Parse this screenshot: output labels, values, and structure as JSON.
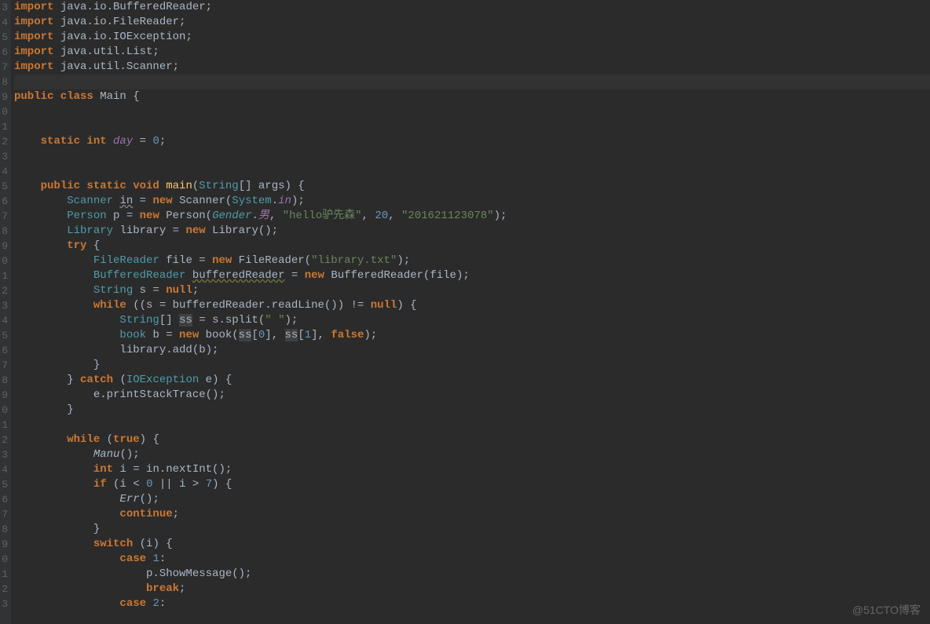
{
  "watermark": "@51CTO博客",
  "gutter": [
    "3",
    "4",
    "5",
    "6",
    "7",
    "8",
    "9",
    "0",
    "1",
    "2",
    "3",
    "4",
    "5",
    "6",
    "7",
    "8",
    "9",
    "0",
    "1",
    "2",
    "3",
    "4",
    "5",
    "6",
    "7",
    "8",
    "9",
    "0",
    "1",
    "2",
    "3",
    "4",
    "5",
    "6",
    "7",
    "8",
    "9",
    "0",
    "1",
    "2",
    "3"
  ],
  "code": {
    "l3": {
      "p": [
        {
          "t": "import ",
          "c": "kw"
        },
        {
          "t": "java.io.BufferedReader;",
          "c": ""
        }
      ]
    },
    "l4": {
      "p": [
        {
          "t": "import ",
          "c": "kw"
        },
        {
          "t": "java.io.FileReader;",
          "c": ""
        }
      ]
    },
    "l5": {
      "p": [
        {
          "t": "import ",
          "c": "kw"
        },
        {
          "t": "java.io.IOException;",
          "c": ""
        }
      ]
    },
    "l6": {
      "p": [
        {
          "t": "import ",
          "c": "kw"
        },
        {
          "t": "java.util.List;",
          "c": ""
        }
      ]
    },
    "l7": {
      "p": [
        {
          "t": "import ",
          "c": "kw"
        },
        {
          "t": "java.util.Scanner;",
          "c": ""
        }
      ]
    },
    "l8": {
      "p": [
        {
          "t": "",
          "c": ""
        }
      ]
    },
    "l9": {
      "p": [
        {
          "t": "public class ",
          "c": "kw"
        },
        {
          "t": "Main ",
          "c": "cls"
        },
        {
          "t": "{",
          "c": ""
        }
      ]
    },
    "l10": {
      "p": [
        {
          "t": "",
          "c": ""
        }
      ]
    },
    "l11": {
      "p": [
        {
          "t": "",
          "c": ""
        }
      ]
    },
    "l12": {
      "p": [
        {
          "t": "    ",
          "c": ""
        },
        {
          "t": "static int ",
          "c": "kw"
        },
        {
          "t": "day",
          "c": "field"
        },
        {
          "t": " = ",
          "c": ""
        },
        {
          "t": "0",
          "c": "num"
        },
        {
          "t": ";",
          "c": ""
        }
      ]
    },
    "l13": {
      "p": [
        {
          "t": "",
          "c": ""
        }
      ]
    },
    "l14": {
      "p": [
        {
          "t": "",
          "c": ""
        }
      ]
    },
    "l15": {
      "p": [
        {
          "t": "    ",
          "c": ""
        },
        {
          "t": "public static void ",
          "c": "kw"
        },
        {
          "t": "main",
          "c": "fn"
        },
        {
          "t": "(",
          "c": ""
        },
        {
          "t": "String",
          "c": "type"
        },
        {
          "t": "[] args) {",
          "c": ""
        }
      ]
    },
    "l16": {
      "p": [
        {
          "t": "        ",
          "c": ""
        },
        {
          "t": "Scanner ",
          "c": "type"
        },
        {
          "t": "in",
          "c": "under"
        },
        {
          "t": " = ",
          "c": ""
        },
        {
          "t": "new ",
          "c": "kw"
        },
        {
          "t": "Scanner(",
          "c": ""
        },
        {
          "t": "System",
          "c": "type"
        },
        {
          "t": ".",
          "c": ""
        },
        {
          "t": "in",
          "c": "field"
        },
        {
          "t": ");",
          "c": ""
        }
      ]
    },
    "l17": {
      "p": [
        {
          "t": "        ",
          "c": ""
        },
        {
          "t": "Person ",
          "c": "type"
        },
        {
          "t": "p = ",
          "c": ""
        },
        {
          "t": "new ",
          "c": "kw"
        },
        {
          "t": "Person(",
          "c": ""
        },
        {
          "t": "Gender",
          "c": "type italic"
        },
        {
          "t": ".",
          "c": ""
        },
        {
          "t": "男",
          "c": "field"
        },
        {
          "t": ", ",
          "c": ""
        },
        {
          "t": "\"hello驴先森\"",
          "c": "str"
        },
        {
          "t": ", ",
          "c": ""
        },
        {
          "t": "20",
          "c": "num"
        },
        {
          "t": ", ",
          "c": ""
        },
        {
          "t": "\"201621123078\"",
          "c": "str"
        },
        {
          "t": ");",
          "c": ""
        }
      ]
    },
    "l18": {
      "p": [
        {
          "t": "        ",
          "c": ""
        },
        {
          "t": "Library ",
          "c": "type"
        },
        {
          "t": "library = ",
          "c": ""
        },
        {
          "t": "new ",
          "c": "kw"
        },
        {
          "t": "Library();",
          "c": ""
        }
      ]
    },
    "l19": {
      "p": [
        {
          "t": "        ",
          "c": ""
        },
        {
          "t": "try ",
          "c": "kw"
        },
        {
          "t": "{",
          "c": ""
        }
      ]
    },
    "l20": {
      "p": [
        {
          "t": "            ",
          "c": ""
        },
        {
          "t": "FileReader ",
          "c": "type"
        },
        {
          "t": "file = ",
          "c": ""
        },
        {
          "t": "new ",
          "c": "kw"
        },
        {
          "t": "FileReader(",
          "c": ""
        },
        {
          "t": "\"library.txt\"",
          "c": "str"
        },
        {
          "t": ");",
          "c": ""
        }
      ]
    },
    "l21": {
      "p": [
        {
          "t": "            ",
          "c": ""
        },
        {
          "t": "BufferedReader ",
          "c": "type"
        },
        {
          "t": "bufferedReader",
          "c": "under2"
        },
        {
          "t": " = ",
          "c": ""
        },
        {
          "t": "new ",
          "c": "kw"
        },
        {
          "t": "BufferedReader(file);",
          "c": ""
        }
      ]
    },
    "l22": {
      "p": [
        {
          "t": "            ",
          "c": ""
        },
        {
          "t": "String ",
          "c": "type"
        },
        {
          "t": "s = ",
          "c": ""
        },
        {
          "t": "null",
          "c": "kw"
        },
        {
          "t": ";",
          "c": ""
        }
      ]
    },
    "l23": {
      "p": [
        {
          "t": "            ",
          "c": ""
        },
        {
          "t": "while ",
          "c": "kw"
        },
        {
          "t": "((s = bufferedReader.readLine()) != ",
          "c": ""
        },
        {
          "t": "null",
          "c": "kw"
        },
        {
          "t": ") {",
          "c": ""
        }
      ]
    },
    "l24": {
      "p": [
        {
          "t": "                ",
          "c": ""
        },
        {
          "t": "String",
          "c": "type"
        },
        {
          "t": "[] ",
          "c": ""
        },
        {
          "t": "ss",
          "c": "hlbox"
        },
        {
          "t": " = s.split(",
          "c": ""
        },
        {
          "t": "\" \"",
          "c": "str"
        },
        {
          "t": ");",
          "c": ""
        }
      ]
    },
    "l25": {
      "p": [
        {
          "t": "                ",
          "c": ""
        },
        {
          "t": "book ",
          "c": "type"
        },
        {
          "t": "b = ",
          "c": ""
        },
        {
          "t": "new ",
          "c": "kw"
        },
        {
          "t": "book(",
          "c": ""
        },
        {
          "t": "ss",
          "c": "hlbox"
        },
        {
          "t": "[",
          "c": ""
        },
        {
          "t": "0",
          "c": "num"
        },
        {
          "t": "], ",
          "c": ""
        },
        {
          "t": "ss",
          "c": "hlbox"
        },
        {
          "t": "[",
          "c": ""
        },
        {
          "t": "1",
          "c": "num"
        },
        {
          "t": "], ",
          "c": ""
        },
        {
          "t": "false",
          "c": "kw"
        },
        {
          "t": ");",
          "c": ""
        }
      ]
    },
    "l26": {
      "p": [
        {
          "t": "                library.add(b);",
          "c": ""
        }
      ]
    },
    "l27": {
      "p": [
        {
          "t": "            }",
          "c": ""
        }
      ]
    },
    "l28": {
      "p": [
        {
          "t": "        } ",
          "c": ""
        },
        {
          "t": "catch ",
          "c": "kw"
        },
        {
          "t": "(",
          "c": ""
        },
        {
          "t": "IOException ",
          "c": "type"
        },
        {
          "t": "e) {",
          "c": ""
        }
      ]
    },
    "l29": {
      "p": [
        {
          "t": "            e.printStackTrace();",
          "c": ""
        }
      ]
    },
    "l30": {
      "p": [
        {
          "t": "        }",
          "c": ""
        }
      ]
    },
    "l31": {
      "p": [
        {
          "t": "",
          "c": ""
        }
      ]
    },
    "l32": {
      "p": [
        {
          "t": "        ",
          "c": ""
        },
        {
          "t": "while ",
          "c": "kw"
        },
        {
          "t": "(",
          "c": ""
        },
        {
          "t": "true",
          "c": "kw"
        },
        {
          "t": ") {",
          "c": ""
        }
      ]
    },
    "l33": {
      "p": [
        {
          "t": "            ",
          "c": ""
        },
        {
          "t": "Manu",
          "c": "italic"
        },
        {
          "t": "();",
          "c": ""
        }
      ]
    },
    "l34": {
      "p": [
        {
          "t": "            ",
          "c": ""
        },
        {
          "t": "int ",
          "c": "kw"
        },
        {
          "t": "i = in.nextInt();",
          "c": ""
        }
      ]
    },
    "l35": {
      "p": [
        {
          "t": "            ",
          "c": ""
        },
        {
          "t": "if ",
          "c": "kw"
        },
        {
          "t": "(i < ",
          "c": ""
        },
        {
          "t": "0 ",
          "c": "num"
        },
        {
          "t": "|| i > ",
          "c": ""
        },
        {
          "t": "7",
          "c": "num"
        },
        {
          "t": ") {",
          "c": ""
        }
      ]
    },
    "l36": {
      "p": [
        {
          "t": "                ",
          "c": ""
        },
        {
          "t": "Err",
          "c": "italic"
        },
        {
          "t": "();",
          "c": ""
        }
      ]
    },
    "l37": {
      "p": [
        {
          "t": "                ",
          "c": ""
        },
        {
          "t": "continue",
          "c": "kw"
        },
        {
          "t": ";",
          "c": ""
        }
      ]
    },
    "l38": {
      "p": [
        {
          "t": "            }",
          "c": ""
        }
      ]
    },
    "l39": {
      "p": [
        {
          "t": "            ",
          "c": ""
        },
        {
          "t": "switch ",
          "c": "kw"
        },
        {
          "t": "(i) {",
          "c": ""
        }
      ]
    },
    "l40": {
      "p": [
        {
          "t": "                ",
          "c": ""
        },
        {
          "t": "case ",
          "c": "kw"
        },
        {
          "t": "1",
          "c": "num"
        },
        {
          "t": ":",
          "c": ""
        }
      ]
    },
    "l41": {
      "p": [
        {
          "t": "                    p.ShowMessage();",
          "c": ""
        }
      ]
    },
    "l42": {
      "p": [
        {
          "t": "                    ",
          "c": ""
        },
        {
          "t": "break",
          "c": "kw"
        },
        {
          "t": ";",
          "c": ""
        }
      ]
    },
    "l43": {
      "p": [
        {
          "t": "                ",
          "c": ""
        },
        {
          "t": "case ",
          "c": "kw"
        },
        {
          "t": "2",
          "c": "num"
        },
        {
          "t": ":",
          "c": ""
        }
      ]
    }
  }
}
